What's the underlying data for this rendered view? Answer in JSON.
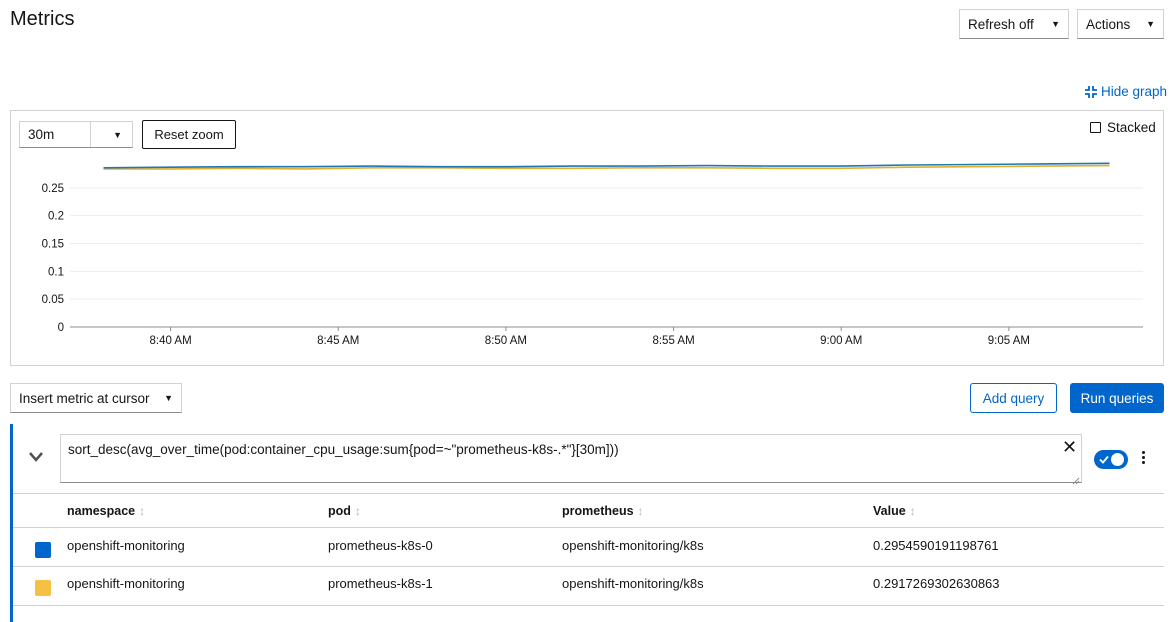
{
  "page": {
    "title": "Metrics",
    "refresh_label": "Refresh off",
    "actions_label": "Actions",
    "hide_graph_label": "Hide graph"
  },
  "graph": {
    "time_range": "30m",
    "reset_zoom_label": "Reset zoom",
    "stacked_label": "Stacked",
    "stacked_checked": false
  },
  "toolbar": {
    "insert_metric_label": "Insert metric at cursor",
    "add_query_label": "Add query",
    "run_queries_label": "Run queries"
  },
  "query": {
    "expression": "sort_desc(avg_over_time(pod:container_cpu_usage:sum{pod=~\"prometheus-k8s-.*\"}[30m]))",
    "enabled": true
  },
  "table": {
    "columns": [
      "namespace",
      "pod",
      "prometheus",
      "Value"
    ],
    "rows": [
      {
        "color": "#06c",
        "namespace": "openshift-monitoring",
        "pod": "prometheus-k8s-0",
        "prometheus": "openshift-monitoring/k8s",
        "value": "0.2954590191198761"
      },
      {
        "color": "#f4c145",
        "namespace": "openshift-monitoring",
        "pod": "prometheus-k8s-1",
        "prometheus": "openshift-monitoring/k8s",
        "value": "0.2917269302630863"
      }
    ]
  },
  "chart_data": {
    "type": "line",
    "x_tick_labels": [
      "8:40 AM",
      "8:45 AM",
      "8:50 AM",
      "8:55 AM",
      "9:00 AM",
      "9:05 AM"
    ],
    "y_tick_labels": [
      "0",
      "0.05",
      "0.1",
      "0.15",
      "0.2",
      "0.25"
    ],
    "ylim": [
      0,
      0.3
    ],
    "grid": true,
    "series": [
      {
        "color": "#1f77b4",
        "x": [
          "8:38 AM",
          "8:40 AM",
          "8:42 AM",
          "8:44 AM",
          "8:46 AM",
          "8:48 AM",
          "8:50 AM",
          "8:52 AM",
          "8:54 AM",
          "8:56 AM",
          "8:58 AM",
          "9:00 AM",
          "9:02 AM",
          "9:04 AM",
          "9:06 AM",
          "9:08 AM"
        ],
        "values": [
          0.286,
          0.287,
          0.288,
          0.288,
          0.289,
          0.288,
          0.288,
          0.289,
          0.289,
          0.29,
          0.289,
          0.289,
          0.291,
          0.292,
          0.293,
          0.294
        ]
      },
      {
        "color": "#e0b12b",
        "x": [
          "8:38 AM",
          "8:40 AM",
          "8:42 AM",
          "8:44 AM",
          "8:46 AM",
          "8:48 AM",
          "8:50 AM",
          "8:52 AM",
          "8:54 AM",
          "8:56 AM",
          "8:58 AM",
          "9:00 AM",
          "9:02 AM",
          "9:04 AM",
          "9:06 AM",
          "9:08 AM"
        ],
        "values": [
          0.284,
          0.284,
          0.285,
          0.284,
          0.286,
          0.286,
          0.285,
          0.285,
          0.286,
          0.286,
          0.285,
          0.285,
          0.287,
          0.288,
          0.289,
          0.29
        ]
      }
    ]
  }
}
